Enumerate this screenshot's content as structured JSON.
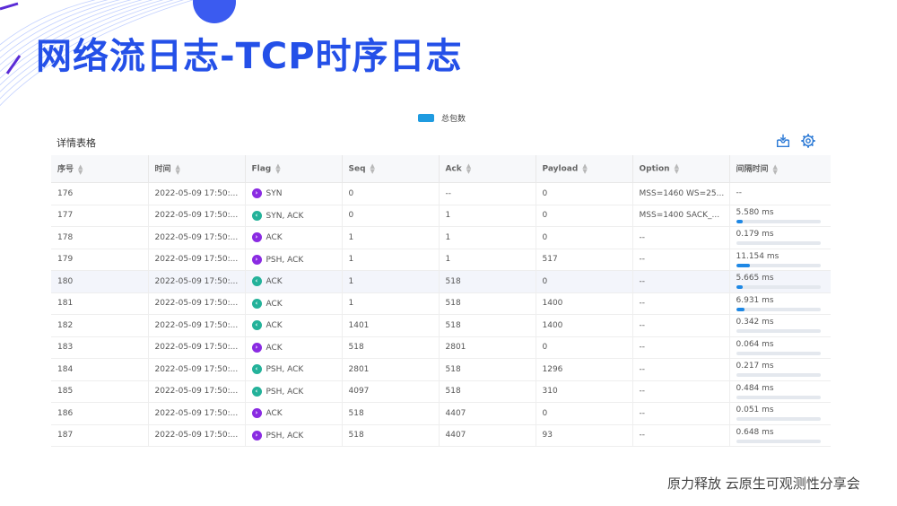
{
  "slide": {
    "title": "网络流日志-TCP时序日志",
    "footer": "原力释放  云原生可观测性分享会"
  },
  "panel": {
    "legend_label": "总包数",
    "legend_color": "#1f9be0",
    "section_title": "详情表格",
    "icons": [
      "download-icon",
      "settings-gear-icon"
    ]
  },
  "table": {
    "headers": [
      "序号",
      "时间",
      "Flag",
      "Seq",
      "Ack",
      "Payload",
      "Option",
      "间隔时间"
    ],
    "rows": [
      {
        "id": "176",
        "time": "2022-05-09 17:50:...",
        "flag": "SYN",
        "dir": "out",
        "seq": "0",
        "ack": "--",
        "payload": "0",
        "option": "MSS=1460 WS=25...",
        "interval": "--",
        "fill": null
      },
      {
        "id": "177",
        "time": "2022-05-09 17:50:...",
        "flag": "SYN, ACK",
        "dir": "in",
        "seq": "0",
        "ack": "1",
        "payload": "0",
        "option": "MSS=1400 SACK_...",
        "interval": "5.580 ms",
        "fill": 0.08
      },
      {
        "id": "178",
        "time": "2022-05-09 17:50:...",
        "flag": "ACK",
        "dir": "out",
        "seq": "1",
        "ack": "1",
        "payload": "0",
        "option": "--",
        "interval": "0.179 ms",
        "fill": 0.0
      },
      {
        "id": "179",
        "time": "2022-05-09 17:50:...",
        "flag": "PSH, ACK",
        "dir": "out",
        "seq": "1",
        "ack": "1",
        "payload": "517",
        "option": "--",
        "interval": "11.154 ms",
        "fill": 0.17
      },
      {
        "id": "180",
        "time": "2022-05-09 17:50:...",
        "flag": "ACK",
        "dir": "in",
        "seq": "1",
        "ack": "518",
        "payload": "0",
        "option": "--",
        "interval": "5.665 ms",
        "fill": 0.08
      },
      {
        "id": "181",
        "time": "2022-05-09 17:50:...",
        "flag": "ACK",
        "dir": "in",
        "seq": "1",
        "ack": "518",
        "payload": "1400",
        "option": "--",
        "interval": "6.931 ms",
        "fill": 0.1
      },
      {
        "id": "182",
        "time": "2022-05-09 17:50:...",
        "flag": "ACK",
        "dir": "in",
        "seq": "1401",
        "ack": "518",
        "payload": "1400",
        "option": "--",
        "interval": "0.342 ms",
        "fill": 0.0
      },
      {
        "id": "183",
        "time": "2022-05-09 17:50:...",
        "flag": "ACK",
        "dir": "out",
        "seq": "518",
        "ack": "2801",
        "payload": "0",
        "option": "--",
        "interval": "0.064 ms",
        "fill": 0.0
      },
      {
        "id": "184",
        "time": "2022-05-09 17:50:...",
        "flag": "PSH, ACK",
        "dir": "in",
        "seq": "2801",
        "ack": "518",
        "payload": "1296",
        "option": "--",
        "interval": "0.217 ms",
        "fill": 0.0
      },
      {
        "id": "185",
        "time": "2022-05-09 17:50:...",
        "flag": "PSH, ACK",
        "dir": "in",
        "seq": "4097",
        "ack": "518",
        "payload": "310",
        "option": "--",
        "interval": "0.484 ms",
        "fill": 0.0
      },
      {
        "id": "186",
        "time": "2022-05-09 17:50:...",
        "flag": "ACK",
        "dir": "out",
        "seq": "518",
        "ack": "4407",
        "payload": "0",
        "option": "--",
        "interval": "0.051 ms",
        "fill": 0.0
      },
      {
        "id": "187",
        "time": "2022-05-09 17:50:...",
        "flag": "PSH, ACK",
        "dir": "out",
        "seq": "518",
        "ack": "4407",
        "payload": "93",
        "option": "--",
        "interval": "0.648 ms",
        "fill": 0.0
      }
    ],
    "highlighted_row": "180"
  }
}
